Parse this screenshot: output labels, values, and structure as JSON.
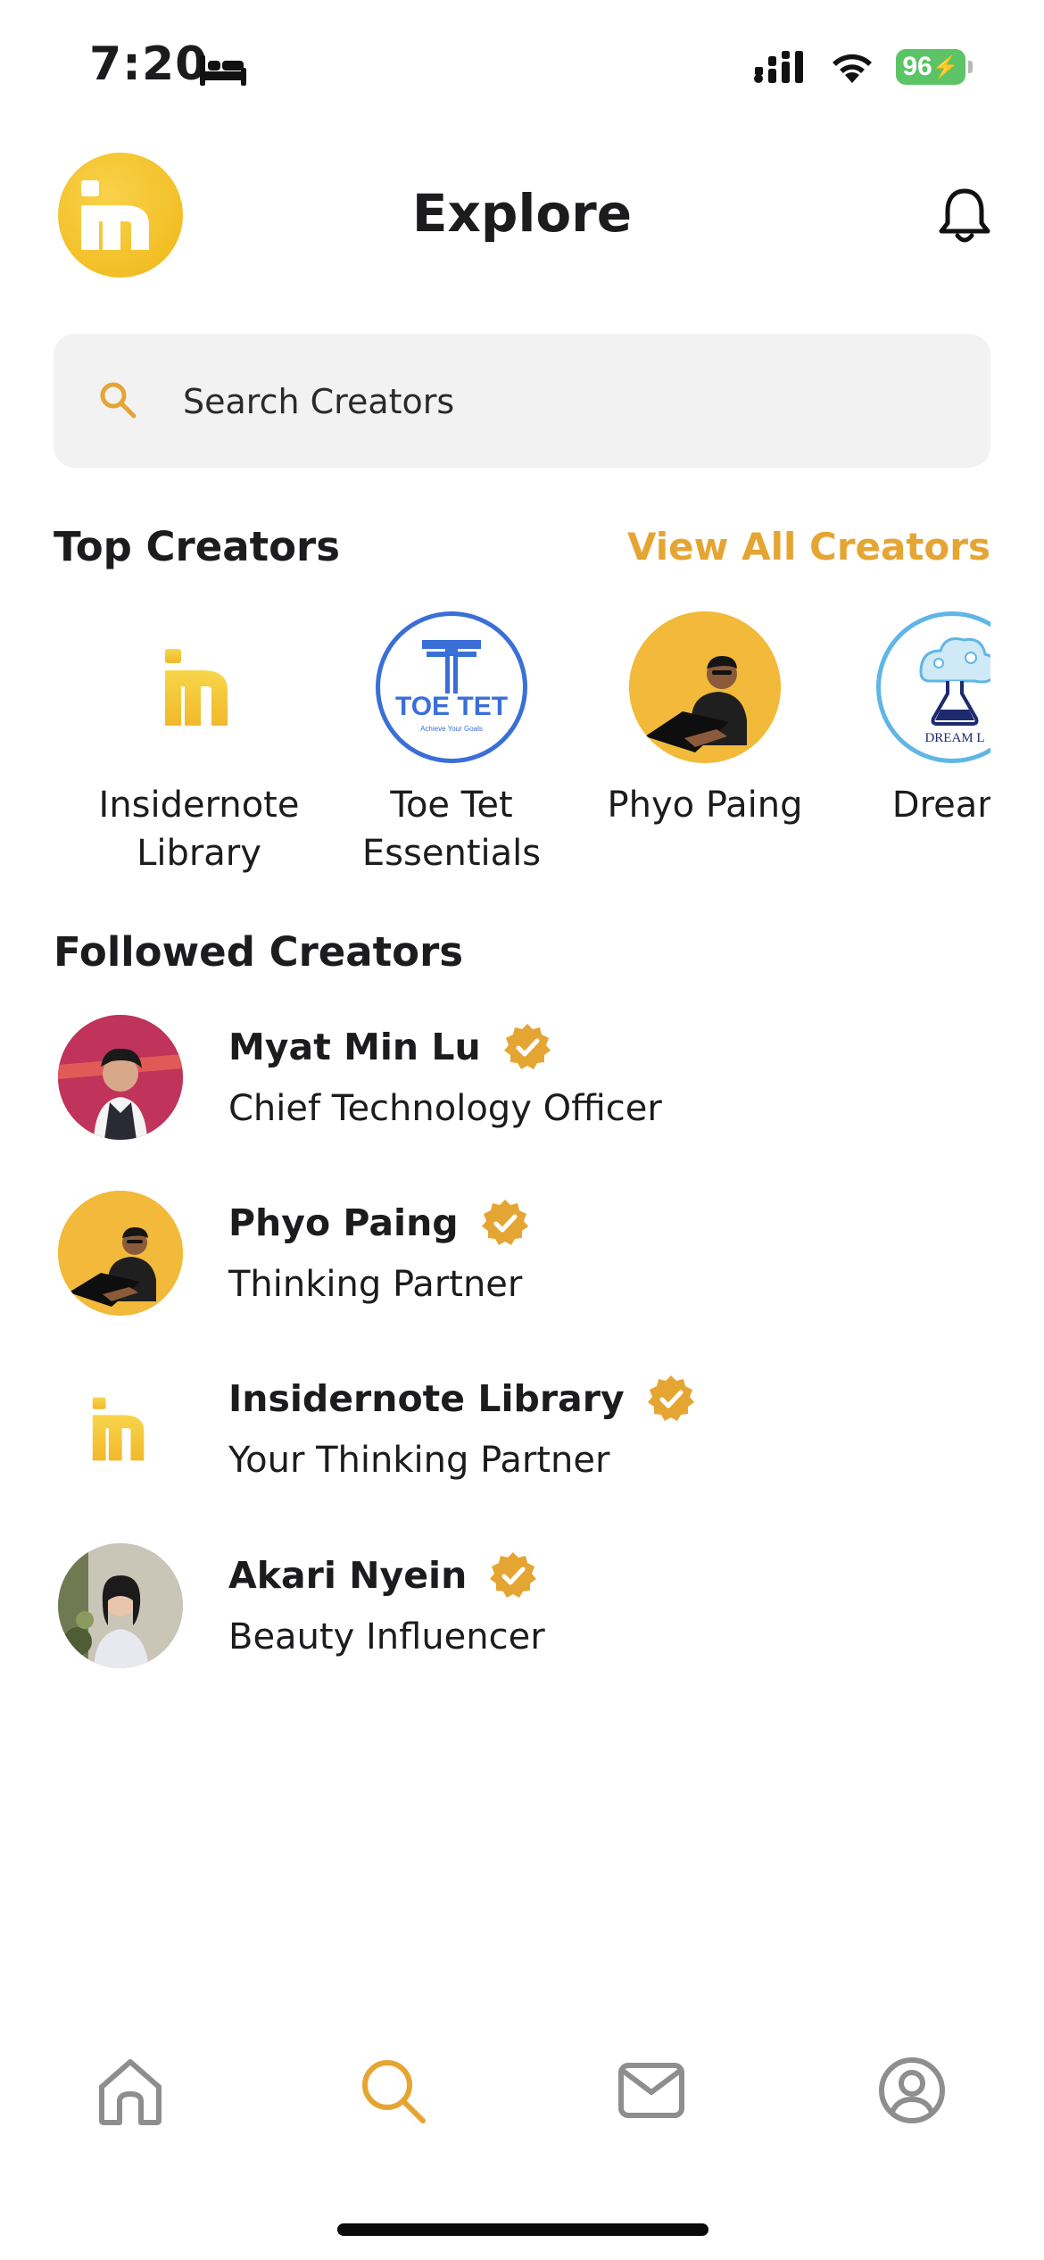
{
  "status_bar": {
    "time": "7:20",
    "battery": "96"
  },
  "header": {
    "title": "Explore"
  },
  "search": {
    "placeholder": "Search Creators"
  },
  "top_creators": {
    "title": "Top Creators",
    "view_all_label": "View All Creators",
    "items": [
      {
        "name": "Insidernote\nLibrary",
        "avatar": "insidernote-logo"
      },
      {
        "name": "Toe Tet\nEssentials",
        "avatar": "toe-tet-logo",
        "logo_text": "TOE TET",
        "logo_tagline": "Achieve Your Goals"
      },
      {
        "name": "Phyo Paing",
        "avatar": "person-photo"
      },
      {
        "name": "Dream",
        "avatar": "dream-lab-logo",
        "logo_text": "DREAM L"
      }
    ]
  },
  "followed_creators": {
    "title": "Followed Creators",
    "items": [
      {
        "name": "Myat Min Lu",
        "subtitle": "Chief Technology Officer",
        "verified": true
      },
      {
        "name": "Phyo Paing",
        "subtitle": "Thinking Partner",
        "verified": true
      },
      {
        "name": "Insidernote Library",
        "subtitle": "Your Thinking Partner",
        "verified": true
      },
      {
        "name": "Akari Nyein",
        "subtitle": "Beauty Influencer",
        "verified": true
      }
    ]
  },
  "tab_bar": {
    "items": [
      {
        "name": "home",
        "icon": "home-icon",
        "active": false
      },
      {
        "name": "explore",
        "icon": "search-icon",
        "active": true
      },
      {
        "name": "messages",
        "icon": "mail-icon",
        "active": false
      },
      {
        "name": "profile",
        "icon": "profile-icon",
        "active": false
      }
    ]
  },
  "colors": {
    "accent": "#e5a533",
    "brand_yellow": "#f3bf27",
    "battery_green": "#5cc466",
    "search_bg": "#f2f2f2",
    "inactive_icon": "#8e8e8e"
  }
}
